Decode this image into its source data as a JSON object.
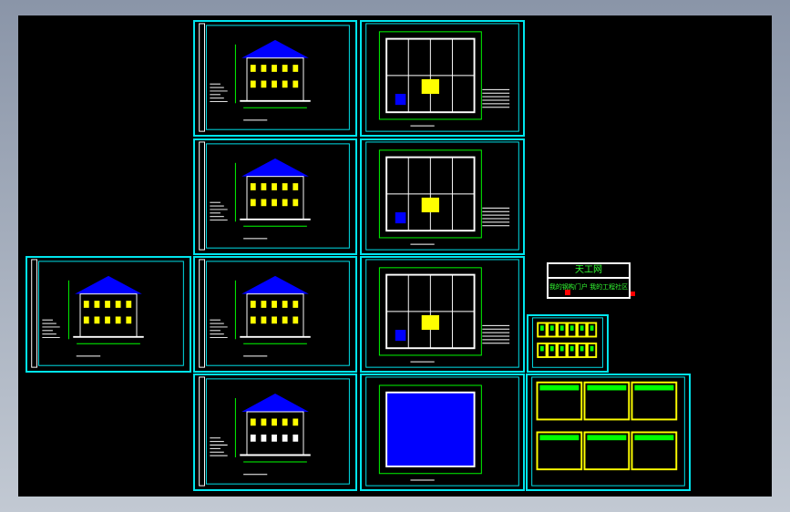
{
  "viewport": {
    "background": "#000000",
    "frame_color": "#00e5ee"
  },
  "colors": {
    "roof": "#0000ff",
    "wall": "#ffff00",
    "dim": "#00ff00",
    "line": "#ffffff"
  },
  "sheets": [
    {
      "id": "A",
      "kind": "elevation"
    },
    {
      "id": "B",
      "kind": "plan"
    },
    {
      "id": "C",
      "kind": "elevation"
    },
    {
      "id": "D",
      "kind": "plan"
    },
    {
      "id": "E",
      "kind": "elevation"
    },
    {
      "id": "F",
      "kind": "elevation"
    },
    {
      "id": "G",
      "kind": "plan"
    },
    {
      "id": "H",
      "kind": "section"
    },
    {
      "id": "I",
      "kind": "roof-plan"
    },
    {
      "id": "J",
      "kind": "details"
    },
    {
      "id": "K",
      "kind": "window-table"
    }
  ],
  "logo": {
    "title": "天工网",
    "subtitle": "我的钢构门户 我的工程社区"
  }
}
